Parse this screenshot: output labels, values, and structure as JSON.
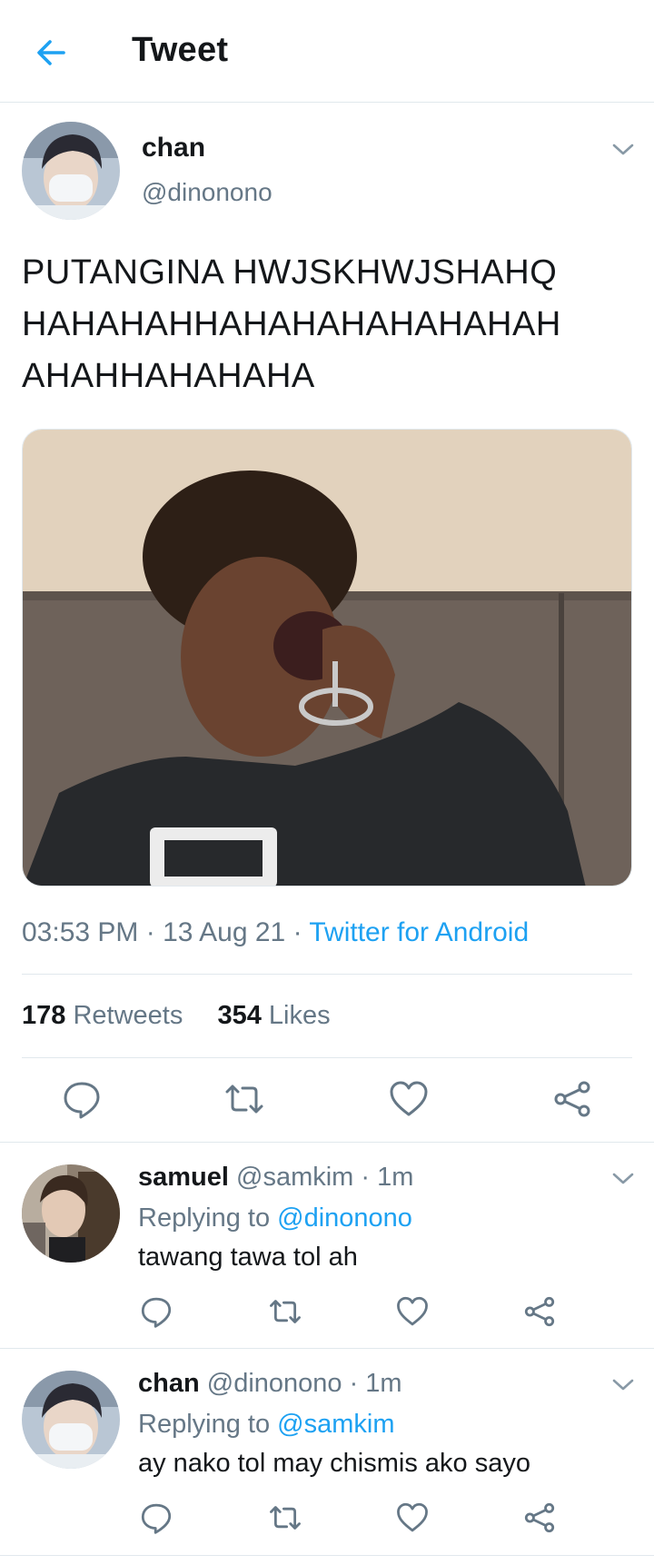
{
  "header": {
    "title": "Tweet",
    "back_icon": "arrow-left-icon"
  },
  "tweet": {
    "author_name": "chan",
    "author_handle": "@dinonono",
    "text": "PUTANGINA HWJSKHWJSHAHQ HAHAHAHHAHAHAHAHAHAHAH AHAHHAHAHAHA",
    "time": "03:53 PM",
    "date": "13 Aug 21",
    "separator": " · ",
    "source": "Twitter for Android",
    "retweets_count": "178",
    "retweets_label": "Retweets",
    "likes_count": "354",
    "likes_label": "Likes"
  },
  "replies": [
    {
      "name": "samuel",
      "handle": "@samkim",
      "time": "· 1m",
      "replying_label": "Replying to",
      "replying_to": "@dinonono",
      "text": "tawang tawa tol ah"
    },
    {
      "name": "chan",
      "handle": "@dinonono",
      "time": "· 1m",
      "replying_label": "Replying to",
      "replying_to": "@samkim",
      "text": "ay nako tol may chismis ako sayo"
    }
  ],
  "colors": {
    "accent": "#1da1f2",
    "secondary_text": "#657786",
    "primary_text": "#14171a",
    "divider": "#e1e8ed"
  },
  "icons": [
    "reply-icon",
    "retweet-icon",
    "like-icon",
    "share-icon",
    "chevron-down-icon"
  ]
}
